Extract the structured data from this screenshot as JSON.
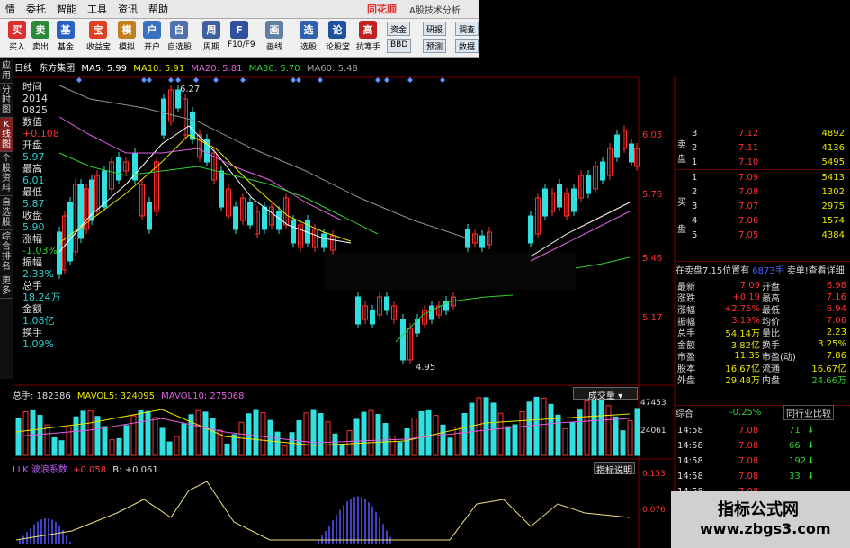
{
  "app": {
    "menus": [
      "情",
      "委托",
      "智能",
      "工具",
      "资讯",
      "帮助"
    ],
    "brand": "同花顺",
    "brand_sub": "A股技术分析"
  },
  "toolbar": {
    "buttons": [
      {
        "label": "买入",
        "glyph": "买",
        "color": "#d83030",
        "icon": "buy-icon"
      },
      {
        "label": "卖出",
        "glyph": "卖",
        "color": "#2a8a3a",
        "icon": "sell-icon"
      },
      {
        "label": "基金",
        "glyph": "基",
        "color": "#2a60c0",
        "icon": "fund-icon"
      },
      {
        "label": "收益宝",
        "glyph": "宝",
        "color": "#e04020",
        "icon": "treasure-icon"
      },
      {
        "label": "模拟",
        "glyph": "模",
        "color": "#c08020",
        "icon": "simulate-icon"
      },
      {
        "label": "开户",
        "glyph": "户",
        "color": "#3a70c0",
        "icon": "open-account-icon"
      },
      {
        "label": "自选股",
        "glyph": "自",
        "color": "#5070b0",
        "icon": "watchlist-icon"
      },
      {
        "label": "周期",
        "glyph": "周",
        "color": "#4060a0",
        "icon": "period-icon"
      },
      {
        "label": "F10/F9",
        "glyph": "F",
        "color": "#3050a0",
        "icon": "f10-icon"
      },
      {
        "label": "画线",
        "glyph": "画",
        "color": "#6080a0",
        "icon": "draw-line-icon"
      },
      {
        "label": "选股",
        "glyph": "选",
        "color": "#3060b0",
        "icon": "stock-picker-icon"
      },
      {
        "label": "论股堂",
        "glyph": "论",
        "color": "#2050a0",
        "icon": "forum-icon"
      },
      {
        "label": "抗寒手",
        "glyph": "高",
        "color": "#c02020",
        "icon": "expert-icon"
      }
    ],
    "menus": [
      "资金",
      "BBD",
      "研报",
      "预测",
      "调查",
      "数据"
    ]
  },
  "nav": [
    "应用",
    "分时图",
    "K线图",
    "个股资料",
    "自选股",
    "综合排名",
    "更多"
  ],
  "chart": {
    "period": "日线",
    "name": "东方集团",
    "ma5": "MA5: 5.99",
    "ma10": "MA10: 5.91",
    "ma20": "MA20: 5.81",
    "ma30": "MA30: 5.70",
    "ma60": "MA60: 5.48",
    "high_label": "6.27",
    "low_label": "4.95",
    "price_ticks": [
      "6.05",
      "5.76",
      "5.46",
      "5.17"
    ],
    "vol_ticks": [
      "47453",
      "24061"
    ],
    "osc_ticks": [
      "0.153",
      "0.076"
    ]
  },
  "datapanel": [
    {
      "label": "时间",
      "value": "2014"
    },
    {
      "label": "",
      "value": "0825"
    },
    {
      "label": "数值",
      "value": "+0.108"
    },
    {
      "label": "开盘",
      "value": "5.97"
    },
    {
      "label": "最高",
      "value": "6.01"
    },
    {
      "label": "最低",
      "value": "5.87"
    },
    {
      "label": "收盘",
      "value": "5.90"
    },
    {
      "label": "涨幅",
      "value": "-1.03%"
    },
    {
      "label": "振幅",
      "value": "2.33%"
    },
    {
      "label": "总手",
      "value": "18.24万"
    },
    {
      "label": "金额",
      "value": "1.08亿"
    },
    {
      "label": "换手",
      "value": "1.09%"
    }
  ],
  "orderbook": {
    "sell_label": "卖盘",
    "buy_label": "买盘",
    "sell": [
      {
        "level": "3",
        "price": "7.12",
        "vol": "4892"
      },
      {
        "level": "2",
        "price": "7.11",
        "vol": "4136"
      },
      {
        "level": "1",
        "price": "7.10",
        "vol": "5495"
      }
    ],
    "buy": [
      {
        "level": "1",
        "price": "7.09",
        "vol": "5413"
      },
      {
        "level": "2",
        "price": "7.08",
        "vol": "1302"
      },
      {
        "level": "3",
        "price": "7.07",
        "vol": "2975"
      },
      {
        "level": "4",
        "price": "7.06",
        "vol": "1574"
      },
      {
        "level": "5",
        "price": "7.05",
        "vol": "4384"
      }
    ],
    "info_left": "在卖盘7.15位置有",
    "info_mid": "6873手",
    "info_right": "卖单!查看详细"
  },
  "stats": [
    {
      "l1": "最新",
      "v1": "7.09",
      "l2": "开盘",
      "v2": "6.98"
    },
    {
      "l1": "涨跌",
      "v1": "+0.19",
      "l2": "最高",
      "v2": "7.16"
    },
    {
      "l1": "涨幅",
      "v1": "+2.75%",
      "l2": "最低",
      "v2": "6.94"
    },
    {
      "l1": "振幅",
      "v1": "3.19%",
      "l2": "均价",
      "v2": "7.06"
    },
    {
      "l1": "总手",
      "v1": "54.14万",
      "l2": "量比",
      "v2": "2.23"
    },
    {
      "l1": "金额",
      "v1": "3.82亿",
      "l2": "换手",
      "v2": "3.25%"
    },
    {
      "l1": "市盈",
      "v1": "11.35",
      "l2": "市盈(动)",
      "v2": "7.86"
    },
    {
      "l1": "股本",
      "v1": "16.67亿",
      "l2": "流通",
      "v2": "16.67亿"
    },
    {
      "l1": "外盘",
      "v1": "29.48万",
      "l2": "内盘",
      "v2": "24.66万"
    }
  ],
  "composite": {
    "label": "综合",
    "change": "-0.25%",
    "compare": "同行业比较"
  },
  "trades": [
    {
      "time": "14:58",
      "price": "7.08",
      "vol": "71"
    },
    {
      "time": "14:58",
      "price": "7.08",
      "vol": "66"
    },
    {
      "time": "14:58",
      "price": "7.08",
      "vol": "192"
    },
    {
      "time": "14:58",
      "price": "7.08",
      "vol": "33"
    },
    {
      "time": "14:58",
      "price": "7.08",
      "vol": ""
    }
  ],
  "volume": {
    "total": "总手: 182386",
    "mavol5": "MAVOL5: 324095",
    "mavol10": "MAVOL10: 275068",
    "dropdown": "成交量"
  },
  "llk": {
    "name": "LLK 波浪系数",
    "value1": "+0.058",
    "b": "B: +0.061",
    "help": "指标说明"
  },
  "watermark": {
    "title": "指标公式网",
    "url": "www.zbgs3.com"
  },
  "chart_data": {
    "type": "candlestick",
    "xlabel": "",
    "ylabel": "",
    "ylim": [
      4.95,
      6.27
    ],
    "annotations": [
      "6.27",
      "4.95"
    ]
  }
}
